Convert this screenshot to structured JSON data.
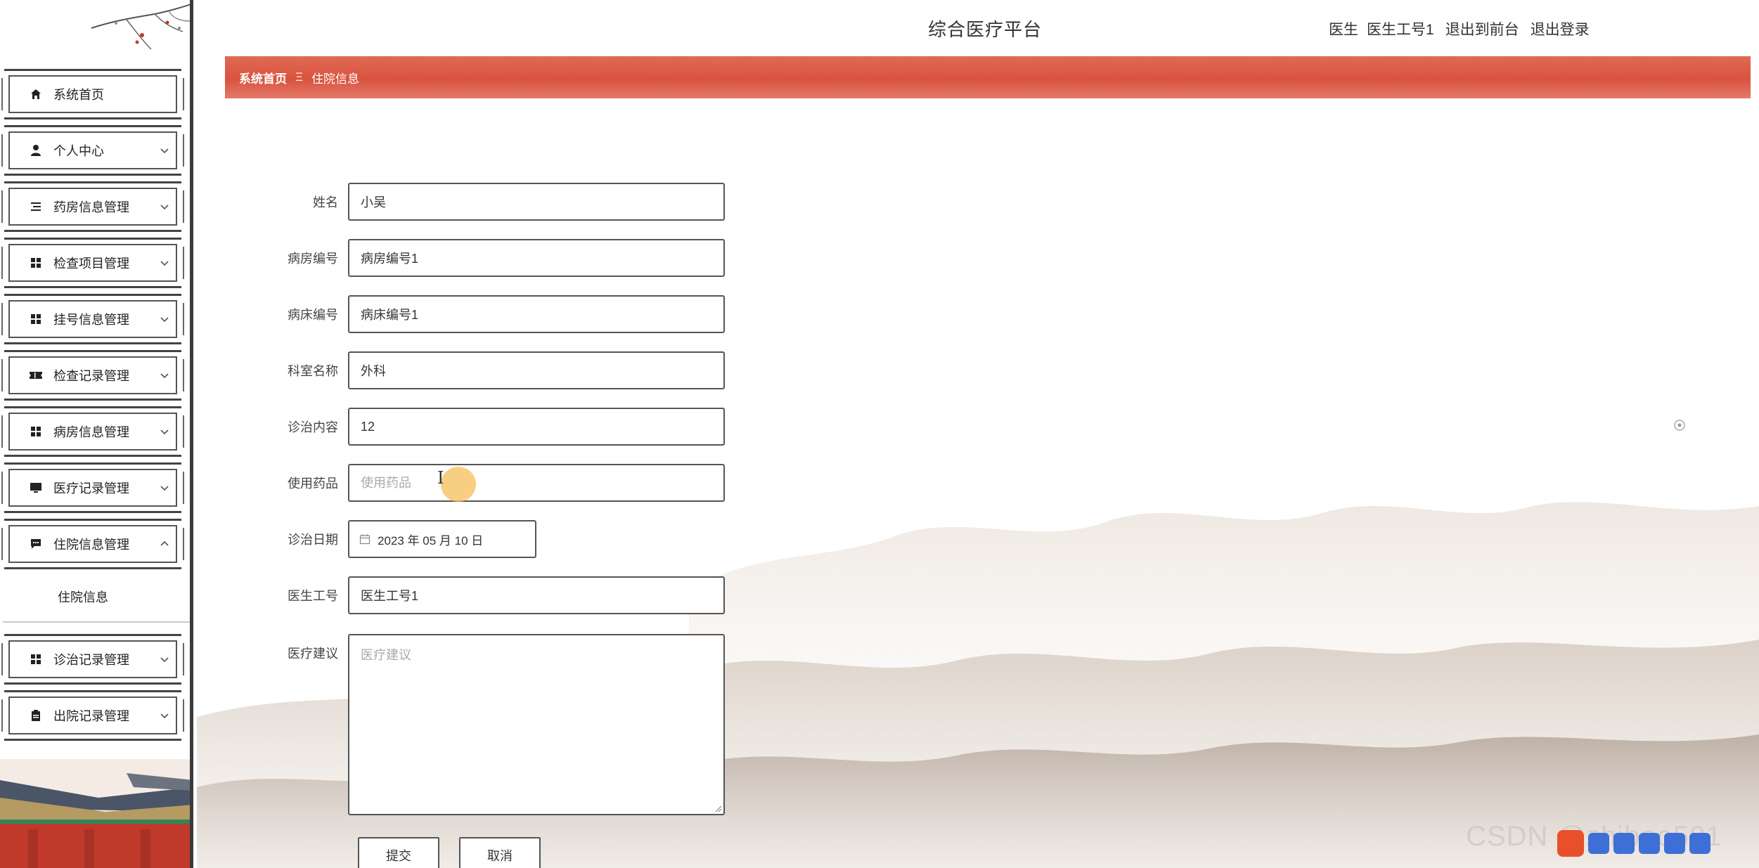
{
  "header": {
    "title": "综合医疗平台",
    "user_role": "医生",
    "user_name": "医生工号1",
    "back_to_front": "退出到前台",
    "logout": "退出登录"
  },
  "breadcrumb": {
    "home": "系统首页",
    "separator": "Ξ",
    "current": "住院信息"
  },
  "sidebar": {
    "items": [
      {
        "label": "系统首页",
        "icon": "home-icon",
        "expandable": false
      },
      {
        "label": "个人中心",
        "icon": "user-icon",
        "expandable": true
      },
      {
        "label": "药房信息管理",
        "icon": "list-icon",
        "expandable": true
      },
      {
        "label": "检查项目管理",
        "icon": "grid-icon",
        "expandable": true
      },
      {
        "label": "挂号信息管理",
        "icon": "grid-icon",
        "expandable": true
      },
      {
        "label": "检查记录管理",
        "icon": "ticket-icon",
        "expandable": true
      },
      {
        "label": "病房信息管理",
        "icon": "grid-icon",
        "expandable": true
      },
      {
        "label": "医疗记录管理",
        "icon": "monitor-icon",
        "expandable": true
      },
      {
        "label": "住院信息管理",
        "icon": "chat-icon",
        "expandable": true,
        "expanded": true
      },
      {
        "label": "诊治记录管理",
        "icon": "grid-icon",
        "expandable": true
      },
      {
        "label": "出院记录管理",
        "icon": "clipboard-icon",
        "expandable": true
      }
    ],
    "submenu": {
      "label": "住院信息"
    }
  },
  "form": {
    "name": {
      "label": "姓名",
      "value": "小吴"
    },
    "ward_no": {
      "label": "病房编号",
      "value": "病房编号1"
    },
    "bed_no": {
      "label": "病床编号",
      "value": "病床编号1"
    },
    "department": {
      "label": "科室名称",
      "value": "外科"
    },
    "treatment": {
      "label": "诊治内容",
      "value": "12"
    },
    "medicine": {
      "label": "使用药品",
      "value": "",
      "placeholder": "使用药品"
    },
    "date": {
      "label": "诊治日期",
      "value": "2023 年 05 月 10 日"
    },
    "doctor_no": {
      "label": "医生工号",
      "value": "医生工号1"
    },
    "advice": {
      "label": "医疗建议",
      "value": "",
      "placeholder": "医疗建议"
    },
    "submit_label": "提交",
    "cancel_label": "取消"
  },
  "overlay": {
    "watermark": "CSDN @zhiboo501"
  },
  "colors": {
    "breadcrumb_bg": "#d9533f",
    "border": "#555555",
    "cursor_highlight": "#f5be5a"
  }
}
